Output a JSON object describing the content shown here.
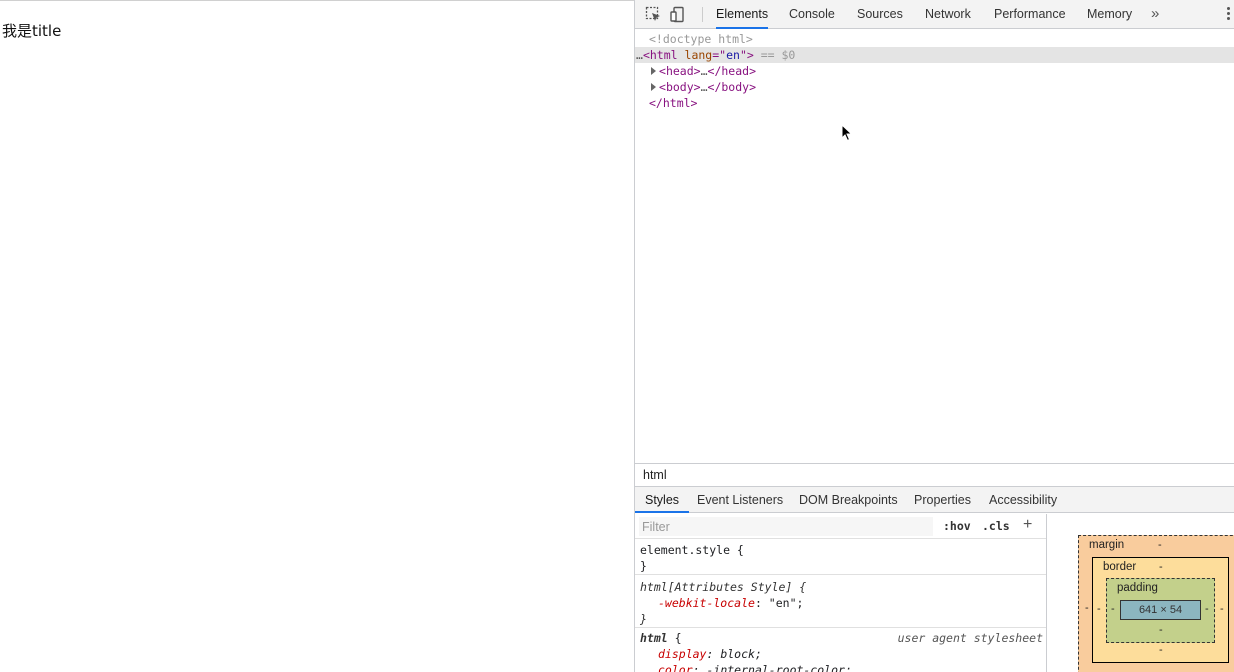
{
  "page": {
    "title": "我是title"
  },
  "devtools": {
    "tabs": [
      {
        "label": "Elements",
        "active": true
      },
      {
        "label": "Console"
      },
      {
        "label": "Sources"
      },
      {
        "label": "Network"
      },
      {
        "label": "Performance"
      },
      {
        "label": "Memory"
      }
    ],
    "dom": {
      "doctype": "<!doctype html>",
      "html_open_tag": "html",
      "html_attr": "lang",
      "html_attr_value": "en",
      "selected_marker": " == $0",
      "head_tag": "head",
      "body_tag": "body",
      "ellipsis": "…",
      "html_close": "</html>"
    },
    "breadcrumb": "html",
    "subtabs": [
      "Styles",
      "Event Listeners",
      "DOM Breakpoints",
      "Properties",
      "Accessibility"
    ],
    "styles": {
      "filter_placeholder": "Filter",
      "hov": ":hov",
      "cls": ".cls",
      "plus": "+",
      "rules": {
        "element_style_selector": "element.style {",
        "close": "}",
        "attr_selector": "html[Attributes Style] {",
        "attr_prop": "-webkit-locale",
        "attr_val": "\"en\";",
        "ua_selector": "html",
        "ua_brace": " {",
        "ua_source": "user agent stylesheet",
        "ua_prop1": "display",
        "ua_val1": "block;",
        "ua_prop2": "color",
        "ua_val2": "-internal-root-color;"
      }
    },
    "box_model": {
      "margin_label": "margin",
      "border_label": "border",
      "padding_label": "padding",
      "content_size": "641 × 54",
      "dash": "-"
    }
  }
}
